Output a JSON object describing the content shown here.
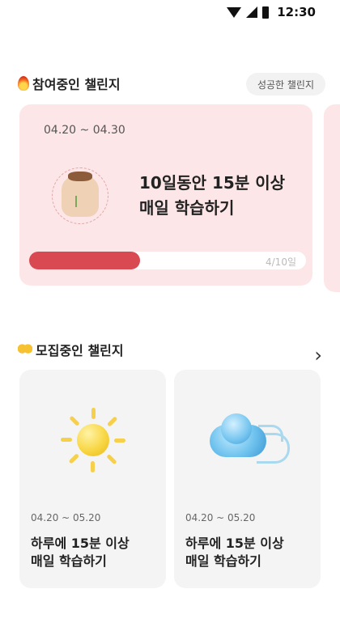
{
  "status_bar": {
    "time": "12:30"
  },
  "participating": {
    "title": "참여중인 챌린지",
    "success_button": "성공한 챌린지",
    "card": {
      "date_range": "04.20 ~ 04.30",
      "title_line1": "10일동안 15분 이상",
      "title_line2": "매일 학습하기",
      "progress_label": "4/10일",
      "progress_value": 0.4
    }
  },
  "recruiting": {
    "title": "모집중인 챌린지",
    "cards": [
      {
        "icon": "sun-icon",
        "date_range": "04.20 ~ 05.20",
        "title_line1": "하루에 15분 이상",
        "title_line2": "매일 학습하기"
      },
      {
        "icon": "wind-cloud-icon",
        "date_range": "04.20 ~ 05.20",
        "title_line1": "하루에 15분 이상",
        "title_line2": "매일 학습하기"
      }
    ]
  },
  "colors": {
    "card_pink": "#fde6e7",
    "progress_red": "#d84952",
    "card_gray": "#f4f4f4"
  }
}
